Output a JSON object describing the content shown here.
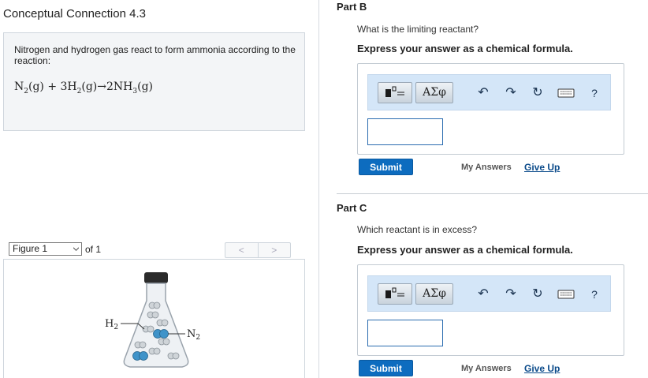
{
  "left": {
    "title": "Conceptual Connection 4.3",
    "intro_text": "Nitrogen and hydrogen gas react to form ammonia according to the reaction:",
    "equation": {
      "n2": "N",
      "n2_sub": "2",
      "n2_state": "(g)",
      "plus": " + ",
      "h2_coef": "3H",
      "h2_sub": "2",
      "h2_state": "(g)",
      "arrow": "→",
      "nh3": "2NH",
      "nh3_sub": "3",
      "nh3_state": "(g)"
    },
    "figure": {
      "select_value": "Figure 1",
      "of_text": "of 1",
      "prev": "<",
      "next": ">",
      "label_h2": "H",
      "label_h2_sub": "2",
      "label_n2": "N",
      "label_n2_sub": "2"
    }
  },
  "parts": [
    {
      "label": "Part B",
      "question": "What is the limiting reactant?",
      "instruction": "Express your answer as a chemical formula.",
      "answer_value": "",
      "submit": "Submit",
      "my_answers": "My Answers",
      "give_up": "Give Up"
    },
    {
      "label": "Part C",
      "question": "Which reactant is in excess?",
      "instruction": "Express your answer as a chemical formula.",
      "answer_value": "",
      "submit": "Submit",
      "my_answers": "My Answers",
      "give_up": "Give Up"
    }
  ],
  "toolbar": {
    "greek_label": "ΑΣφ",
    "undo_glyph": "↶",
    "redo_glyph": "↷",
    "reset_glyph": "↻",
    "help_glyph": "?",
    "icons": [
      "templates-icon",
      "greek-symbols-icon",
      "undo-icon",
      "redo-icon",
      "reset-icon",
      "keyboard-icon",
      "help-icon"
    ]
  },
  "colors": {
    "submit_bg": "#0d6cbf",
    "toolbar_bg": "#d4e6f8",
    "link": "#0a4a8a"
  }
}
